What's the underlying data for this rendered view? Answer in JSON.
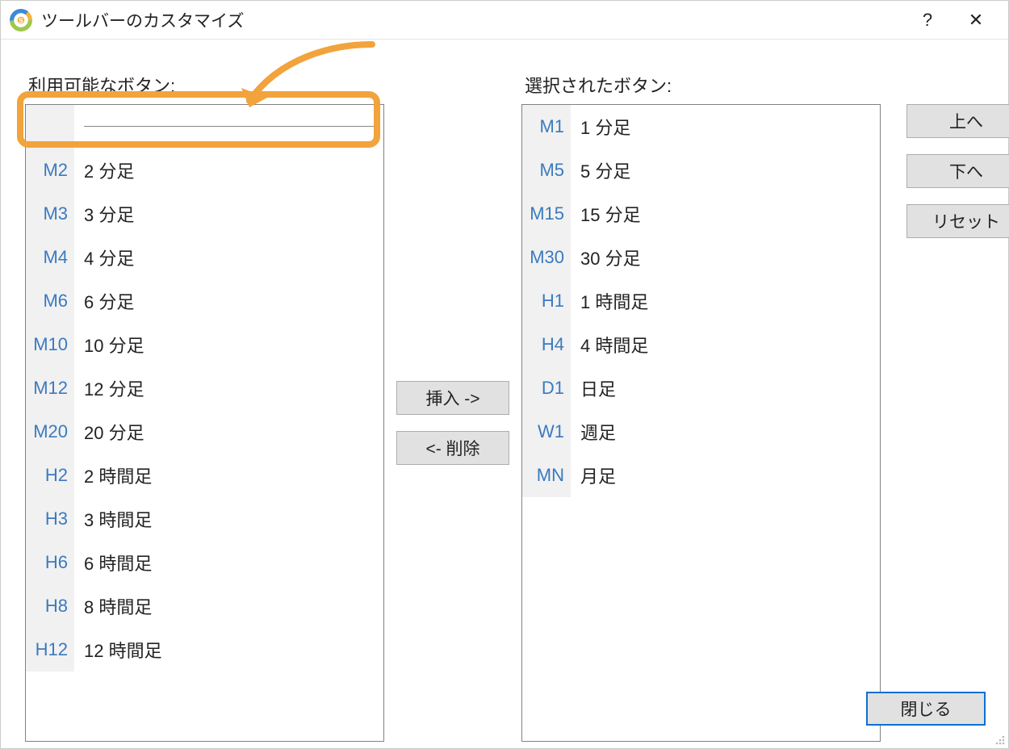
{
  "titlebar": {
    "title": "ツールバーのカスタマイズ",
    "help": "?",
    "close": "✕"
  },
  "labels": {
    "available": "利用可能なボタン:",
    "selected": "選択されたボタン:"
  },
  "available_items": [
    {
      "code": "M2",
      "desc": "2 分足"
    },
    {
      "code": "M3",
      "desc": "3 分足"
    },
    {
      "code": "M4",
      "desc": "4 分足"
    },
    {
      "code": "M6",
      "desc": "6 分足"
    },
    {
      "code": "M10",
      "desc": "10 分足"
    },
    {
      "code": "M12",
      "desc": "12 分足"
    },
    {
      "code": "M20",
      "desc": "20 分足"
    },
    {
      "code": "H2",
      "desc": "2 時間足"
    },
    {
      "code": "H3",
      "desc": "3 時間足"
    },
    {
      "code": "H6",
      "desc": "6 時間足"
    },
    {
      "code": "H8",
      "desc": "8 時間足"
    },
    {
      "code": "H12",
      "desc": "12 時間足"
    }
  ],
  "selected_items": [
    {
      "code": "M1",
      "desc": "1 分足"
    },
    {
      "code": "M5",
      "desc": "5 分足"
    },
    {
      "code": "M15",
      "desc": "15 分足"
    },
    {
      "code": "M30",
      "desc": "30 分足"
    },
    {
      "code": "H1",
      "desc": "1 時間足"
    },
    {
      "code": "H4",
      "desc": "4 時間足"
    },
    {
      "code": "D1",
      "desc": "日足"
    },
    {
      "code": "W1",
      "desc": "週足"
    },
    {
      "code": "MN",
      "desc": "月足"
    }
  ],
  "buttons": {
    "insert": "挿入 ->",
    "remove": "<- 削除",
    "up": "上へ",
    "down": "下へ",
    "reset": "リセット",
    "close": "閉じる"
  }
}
